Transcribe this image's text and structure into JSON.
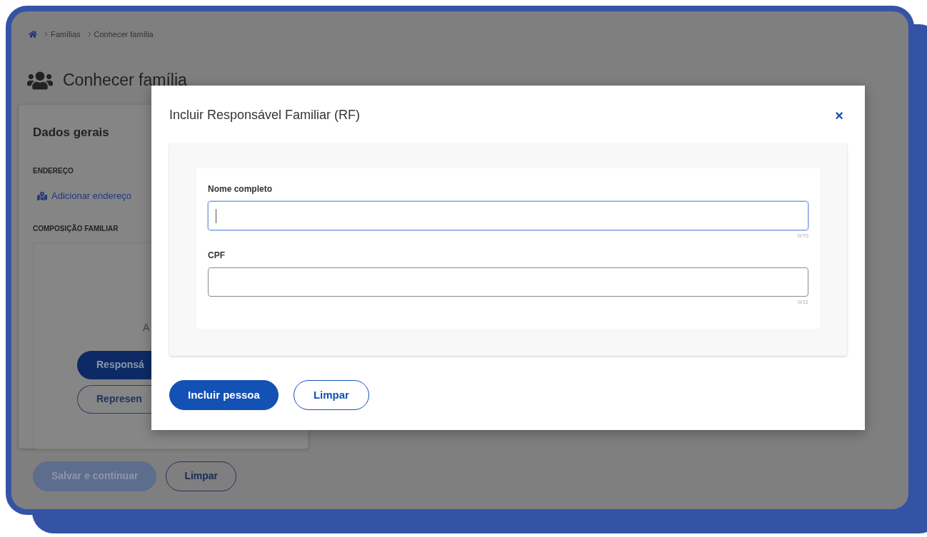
{
  "breadcrumb": {
    "items": [
      "Famílias",
      "Conhecer família"
    ]
  },
  "page_title": "Conhecer família",
  "general_card": {
    "title": "Dados gerais",
    "address_section": {
      "label": "ENDEREÇO",
      "link": "Adicionar endereço"
    },
    "family_section": {
      "label": "COMPOSIÇÃO FAMILIAR",
      "partial_text": "A",
      "buttons": [
        {
          "label": "Responsá",
          "kind": "filled"
        },
        {
          "label": "Represen",
          "kind": "outline"
        }
      ]
    }
  },
  "footer_buttons": [
    {
      "label": "Salvar e continuar",
      "kind": "filled",
      "disabled": true
    },
    {
      "label": "Limpar",
      "kind": "outline",
      "disabled": false
    }
  ],
  "modal": {
    "title": "Incluir Responsável Familiar (RF)",
    "close": "×",
    "fields": [
      {
        "label": "Nome completo",
        "counter": "0/70",
        "focused": true
      },
      {
        "label": "CPF",
        "counter": "0/11",
        "focused": false
      }
    ],
    "buttons": [
      {
        "label": "Incluir pessoa",
        "kind": "filled"
      },
      {
        "label": "Limpar",
        "kind": "outline"
      }
    ]
  }
}
